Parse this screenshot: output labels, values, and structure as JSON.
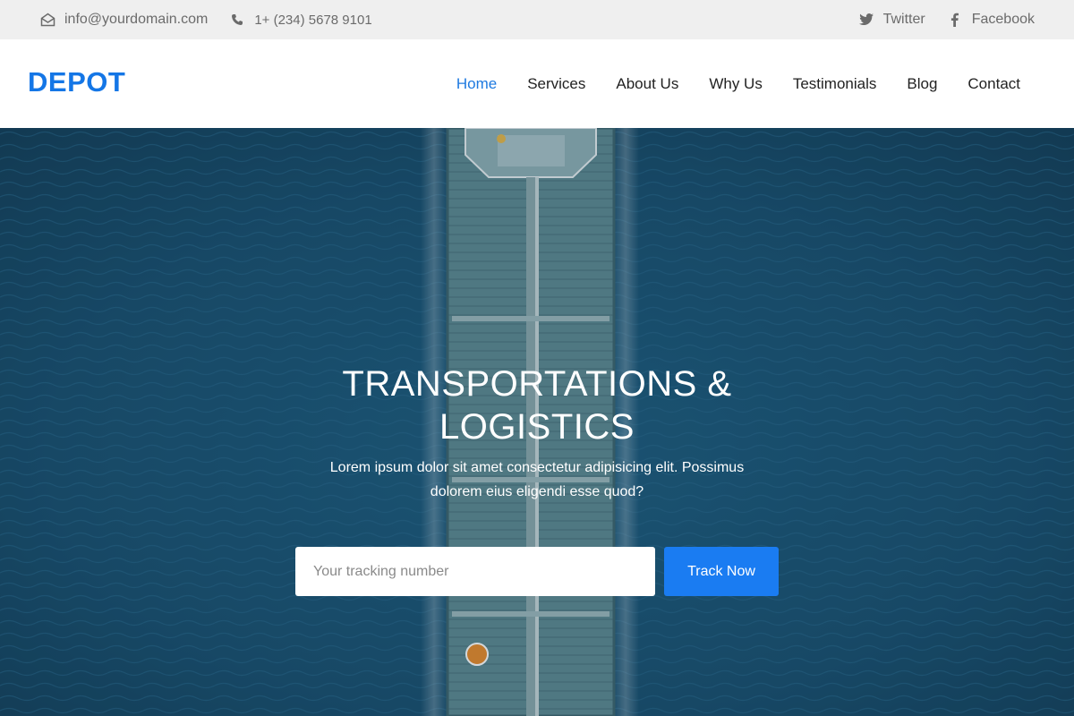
{
  "topbar": {
    "email": {
      "icon": "envelope-open-icon",
      "text": "info@yourdomain.com"
    },
    "phone": {
      "icon": "phone-icon",
      "text": "1+ (234) 5678 9101"
    },
    "twitter": {
      "icon": "twitter-icon",
      "text": "Twitter"
    },
    "facebook": {
      "icon": "facebook-icon",
      "text": "Facebook"
    }
  },
  "header": {
    "logo": "DEPOT",
    "nav": [
      {
        "label": "Home",
        "active": true
      },
      {
        "label": "Services"
      },
      {
        "label": "About Us"
      },
      {
        "label": "Why Us"
      },
      {
        "label": "Testimonials"
      },
      {
        "label": "Blog"
      },
      {
        "label": "Contact"
      }
    ]
  },
  "hero": {
    "title": "TRANSPORTATIONS & LOGISTICS",
    "subtitle": "Lorem ipsum dolor sit amet consectetur adipisicing elit. Possimus dolorem eius eligendi esse quod?",
    "tracking_placeholder": "Your tracking number",
    "tracking_value": "",
    "track_button": "Track Now"
  },
  "colors": {
    "brand": "#1476e6",
    "nav_active": "#1e7ae0",
    "button": "#1a7cf2",
    "topbar_bg": "#efefef",
    "ocean": "#1b5474"
  }
}
